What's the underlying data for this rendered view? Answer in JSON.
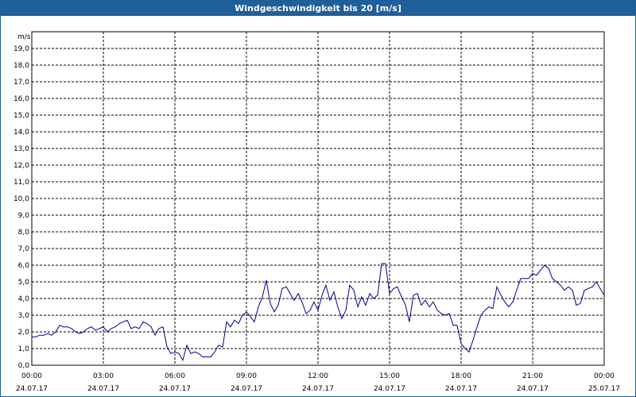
{
  "chart_data": {
    "type": "line",
    "title": "Windgeschwindigkeit bis 20 [m/s]",
    "ylabel": "m/s",
    "xlabel": "",
    "ylim": [
      0,
      20
    ],
    "xlim_hours": [
      0,
      24
    ],
    "grid": true,
    "y_ticks": [
      "0,0",
      "1,0",
      "2,0",
      "3,0",
      "4,0",
      "5,0",
      "6,0",
      "7,0",
      "8,0",
      "9,0",
      "10,0",
      "11,0",
      "12,0",
      "13,0",
      "14,0",
      "15,0",
      "16,0",
      "17,0",
      "18,0",
      "19,0"
    ],
    "x_ticks": [
      {
        "time": "00:00",
        "date": "24.07.17"
      },
      {
        "time": "03:00",
        "date": "24.07.17"
      },
      {
        "time": "06:00",
        "date": "24.07.17"
      },
      {
        "time": "09:00",
        "date": "24.07.17"
      },
      {
        "time": "12:00",
        "date": "24.07.17"
      },
      {
        "time": "15:00",
        "date": "24.07.17"
      },
      {
        "time": "18:00",
        "date": "24.07.17"
      },
      {
        "time": "21:00",
        "date": "24.07.17"
      },
      {
        "time": "00:00",
        "date": "25.07.17"
      }
    ],
    "series": [
      {
        "color": "#00008b",
        "points": [
          [
            0.0,
            1.7
          ],
          [
            0.17,
            1.7
          ],
          [
            0.33,
            1.8
          ],
          [
            0.5,
            1.8
          ],
          [
            0.67,
            1.9
          ],
          [
            0.83,
            1.8
          ],
          [
            1.0,
            2.0
          ],
          [
            1.17,
            2.4
          ],
          [
            1.33,
            2.3
          ],
          [
            1.5,
            2.3
          ],
          [
            1.67,
            2.2
          ],
          [
            1.83,
            2.0
          ],
          [
            2.0,
            1.9
          ],
          [
            2.17,
            2.0
          ],
          [
            2.33,
            2.2
          ],
          [
            2.5,
            2.3
          ],
          [
            2.67,
            2.1
          ],
          [
            2.83,
            2.2
          ],
          [
            3.0,
            2.3
          ],
          [
            3.17,
            2.0
          ],
          [
            3.33,
            2.2
          ],
          [
            3.5,
            2.3
          ],
          [
            3.67,
            2.5
          ],
          [
            3.83,
            2.6
          ],
          [
            4.0,
            2.7
          ],
          [
            4.17,
            2.2
          ],
          [
            4.33,
            2.3
          ],
          [
            4.5,
            2.2
          ],
          [
            4.67,
            2.6
          ],
          [
            4.83,
            2.5
          ],
          [
            5.0,
            2.3
          ],
          [
            5.17,
            1.8
          ],
          [
            5.33,
            2.2
          ],
          [
            5.5,
            2.3
          ],
          [
            5.67,
            1.1
          ],
          [
            5.83,
            0.7
          ],
          [
            6.0,
            0.8
          ],
          [
            6.17,
            0.7
          ],
          [
            6.33,
            0.3
          ],
          [
            6.5,
            1.2
          ],
          [
            6.67,
            0.7
          ],
          [
            6.83,
            0.8
          ],
          [
            7.0,
            0.7
          ],
          [
            7.17,
            0.5
          ],
          [
            7.33,
            0.5
          ],
          [
            7.5,
            0.5
          ],
          [
            7.67,
            0.8
          ],
          [
            7.83,
            1.2
          ],
          [
            8.0,
            1.1
          ],
          [
            8.17,
            2.6
          ],
          [
            8.33,
            2.3
          ],
          [
            8.5,
            2.7
          ],
          [
            8.67,
            2.5
          ],
          [
            8.83,
            3.0
          ],
          [
            9.0,
            3.2
          ],
          [
            9.17,
            2.9
          ],
          [
            9.33,
            2.6
          ],
          [
            9.5,
            3.5
          ],
          [
            9.67,
            4.1
          ],
          [
            9.83,
            5.1
          ],
          [
            10.0,
            3.7
          ],
          [
            10.17,
            3.2
          ],
          [
            10.33,
            3.6
          ],
          [
            10.5,
            4.6
          ],
          [
            10.67,
            4.7
          ],
          [
            10.83,
            4.3
          ],
          [
            11.0,
            3.9
          ],
          [
            11.17,
            4.3
          ],
          [
            11.33,
            3.8
          ],
          [
            11.5,
            3.1
          ],
          [
            11.67,
            3.3
          ],
          [
            11.83,
            3.8
          ],
          [
            12.0,
            3.3
          ],
          [
            12.17,
            4.2
          ],
          [
            12.33,
            4.8
          ],
          [
            12.5,
            3.9
          ],
          [
            12.67,
            4.4
          ],
          [
            12.83,
            3.5
          ],
          [
            13.0,
            2.8
          ],
          [
            13.17,
            3.3
          ],
          [
            13.33,
            4.8
          ],
          [
            13.5,
            4.5
          ],
          [
            13.67,
            3.5
          ],
          [
            13.83,
            4.1
          ],
          [
            14.0,
            3.6
          ],
          [
            14.17,
            4.3
          ],
          [
            14.33,
            4.0
          ],
          [
            14.5,
            4.2
          ],
          [
            14.67,
            6.1
          ],
          [
            14.83,
            6.1
          ],
          [
            15.0,
            4.3
          ],
          [
            15.17,
            4.6
          ],
          [
            15.33,
            4.7
          ],
          [
            15.5,
            4.1
          ],
          [
            15.67,
            3.6
          ],
          [
            15.83,
            2.6
          ],
          [
            16.0,
            4.2
          ],
          [
            16.17,
            4.3
          ],
          [
            16.33,
            3.6
          ],
          [
            16.5,
            3.9
          ],
          [
            16.67,
            3.5
          ],
          [
            16.83,
            3.8
          ],
          [
            17.0,
            3.3
          ],
          [
            17.17,
            3.1
          ],
          [
            17.33,
            3.0
          ],
          [
            17.5,
            3.1
          ],
          [
            17.67,
            2.4
          ],
          [
            17.83,
            2.4
          ],
          [
            18.0,
            1.3
          ],
          [
            18.17,
            1.0
          ],
          [
            18.33,
            0.8
          ],
          [
            18.5,
            1.5
          ],
          [
            18.67,
            2.3
          ],
          [
            18.83,
            3.0
          ],
          [
            19.0,
            3.3
          ],
          [
            19.17,
            3.5
          ],
          [
            19.33,
            3.4
          ],
          [
            19.5,
            4.7
          ],
          [
            19.67,
            4.2
          ],
          [
            19.83,
            3.8
          ],
          [
            20.0,
            3.5
          ],
          [
            20.17,
            3.8
          ],
          [
            20.33,
            4.5
          ],
          [
            20.5,
            5.2
          ],
          [
            20.67,
            5.2
          ],
          [
            20.83,
            5.2
          ],
          [
            21.0,
            5.5
          ],
          [
            21.17,
            5.4
          ],
          [
            21.33,
            5.7
          ],
          [
            21.5,
            6.0
          ],
          [
            21.67,
            5.8
          ],
          [
            21.83,
            5.2
          ],
          [
            22.0,
            5.0
          ],
          [
            22.17,
            4.8
          ],
          [
            22.33,
            4.5
          ],
          [
            22.5,
            4.7
          ],
          [
            22.67,
            4.5
          ],
          [
            22.83,
            3.6
          ],
          [
            23.0,
            3.7
          ],
          [
            23.17,
            4.5
          ],
          [
            23.33,
            4.6
          ],
          [
            23.5,
            4.7
          ],
          [
            23.67,
            5.0
          ],
          [
            23.83,
            4.6
          ],
          [
            24.0,
            4.2
          ]
        ]
      }
    ]
  }
}
